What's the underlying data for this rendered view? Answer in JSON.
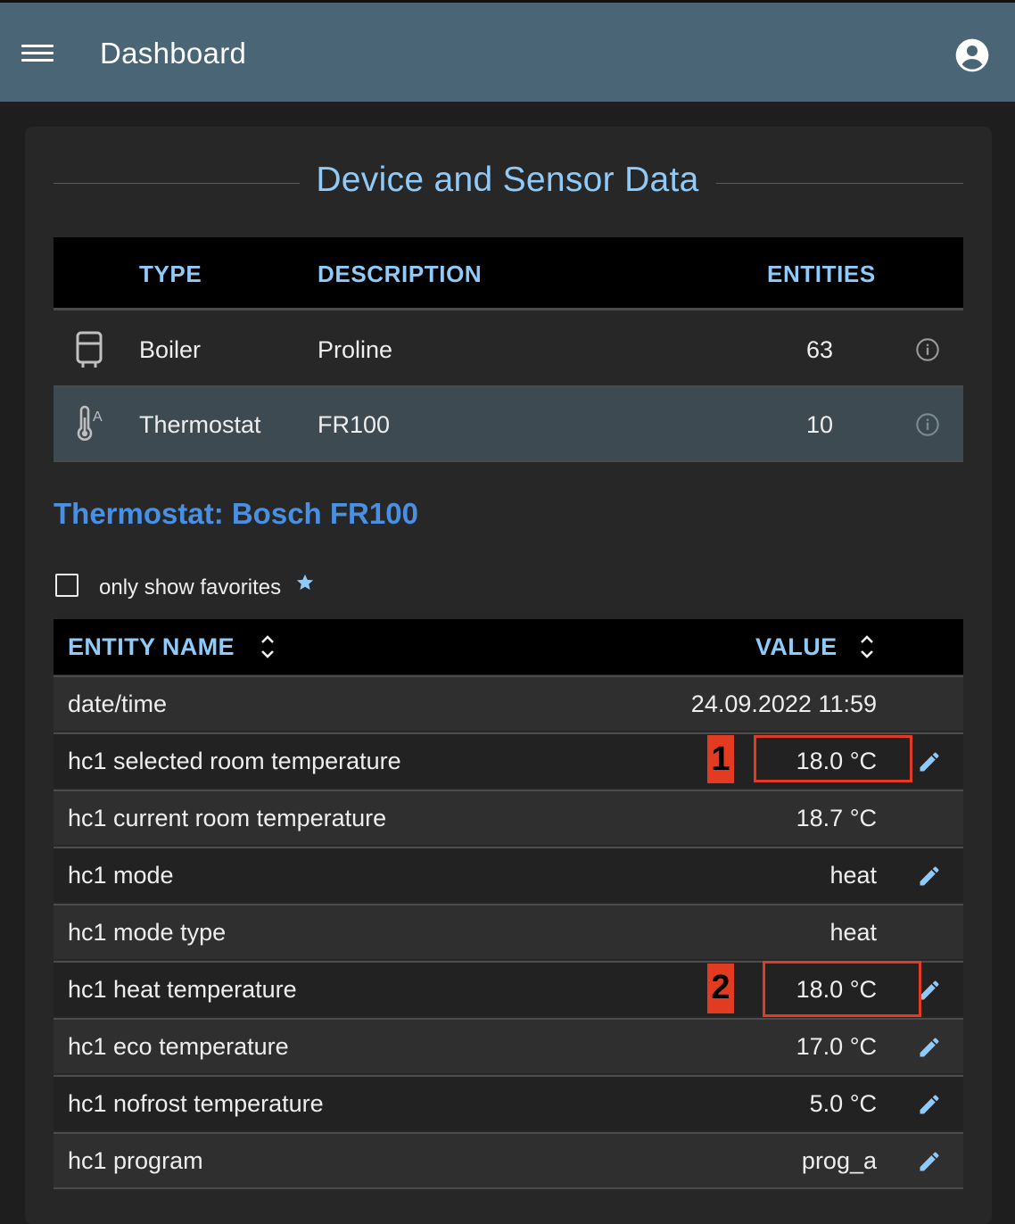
{
  "appbar": {
    "title": "Dashboard"
  },
  "section_title": "Device and Sensor Data",
  "devices": {
    "headers": {
      "type": "TYPE",
      "description": "DESCRIPTION",
      "entities": "ENTITIES"
    },
    "rows": [
      {
        "type": "Boiler",
        "description": "Proline",
        "entities": "63",
        "icon": "boiler-icon"
      },
      {
        "type": "Thermostat",
        "description": "FR100",
        "entities": "10",
        "icon": "thermostat-icon"
      }
    ]
  },
  "device_detail_title": "Thermostat: Bosch FR100",
  "favorites_filter": {
    "label": "only show favorites",
    "checked": false
  },
  "entities": {
    "headers": {
      "name": "ENTITY NAME",
      "value": "VALUE"
    },
    "rows": [
      {
        "name": "date/time",
        "value": "24.09.2022 11:59",
        "editable": false
      },
      {
        "name": "hc1 selected room temperature",
        "value": "18.0 °C",
        "editable": true
      },
      {
        "name": "hc1 current room temperature",
        "value": "18.7 °C",
        "editable": false
      },
      {
        "name": "hc1 mode",
        "value": "heat",
        "editable": true
      },
      {
        "name": "hc1 mode type",
        "value": "heat",
        "editable": false
      },
      {
        "name": "hc1 heat temperature",
        "value": "18.0 °C",
        "editable": true
      },
      {
        "name": "hc1 eco temperature",
        "value": "17.0 °C",
        "editable": true
      },
      {
        "name": "hc1 nofrost temperature",
        "value": "5.0 °C",
        "editable": true
      },
      {
        "name": "hc1 program",
        "value": "prog_a",
        "editable": true
      }
    ]
  },
  "annotations": [
    {
      "number": "1"
    },
    {
      "number": "2"
    }
  ],
  "colors": {
    "appbar": "#4a6575",
    "accent": "#90caf9",
    "link": "#4a90e2",
    "annotation": "#e23b22"
  }
}
